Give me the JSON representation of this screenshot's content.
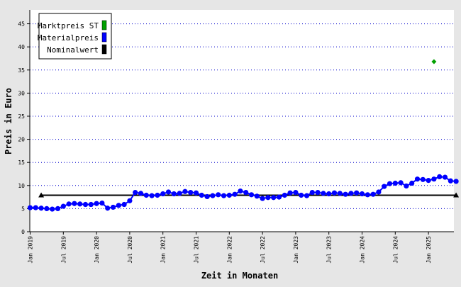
{
  "chart_data": {
    "type": "line",
    "xlabel": "Zeit in Monaten",
    "ylabel": "Preis in Euro",
    "ylim": [
      0,
      48
    ],
    "yticks": [
      0,
      5,
      10,
      15,
      20,
      25,
      30,
      35,
      40,
      45
    ],
    "xticks": [
      "Jan 2019",
      "Jul 2019",
      "Jan 2020",
      "Jul 2020",
      "Jan 2021",
      "Jul 2021",
      "Jan 2022",
      "Jul 2022",
      "Jan 2023",
      "Jul 2023",
      "Jan 2024",
      "Jul 2024",
      "Jan 2025"
    ],
    "grid": true,
    "legend": {
      "position": "top-left"
    },
    "series": [
      {
        "name": "Marktpreis ST",
        "color": "#00a000",
        "marker": "diamond",
        "points": [
          {
            "month_index": 73,
            "value": 36.8
          }
        ]
      },
      {
        "name": "Materialpreis",
        "color": "#0000ff",
        "marker": "circle",
        "start": "Jan 2019",
        "values": [
          5.2,
          5.2,
          5.1,
          5.0,
          4.9,
          5.0,
          5.5,
          6.0,
          6.1,
          6.0,
          5.9,
          5.9,
          6.1,
          6.2,
          5.1,
          5.3,
          5.7,
          5.9,
          6.7,
          8.5,
          8.3,
          7.9,
          7.8,
          7.9,
          8.2,
          8.6,
          8.2,
          8.3,
          8.7,
          8.5,
          8.4,
          7.9,
          7.6,
          7.8,
          8.0,
          7.8,
          7.9,
          8.1,
          8.8,
          8.5,
          8.0,
          7.7,
          7.2,
          7.4,
          7.4,
          7.5,
          7.9,
          8.4,
          8.5,
          7.9,
          7.8,
          8.5,
          8.5,
          8.3,
          8.2,
          8.4,
          8.3,
          8.1,
          8.3,
          8.4,
          8.2,
          8.0,
          8.1,
          8.6,
          9.8,
          10.4,
          10.5,
          10.6,
          9.9,
          10.5,
          11.4,
          11.3,
          11.1,
          11.4,
          11.9,
          11.8,
          11.0,
          10.9
        ]
      },
      {
        "name": "Nominalwert",
        "color": "#000000",
        "marker": "triangle",
        "points": [
          {
            "month_index": 2,
            "value": 7.9
          },
          {
            "month_index": 77,
            "value": 7.9
          }
        ]
      }
    ]
  }
}
